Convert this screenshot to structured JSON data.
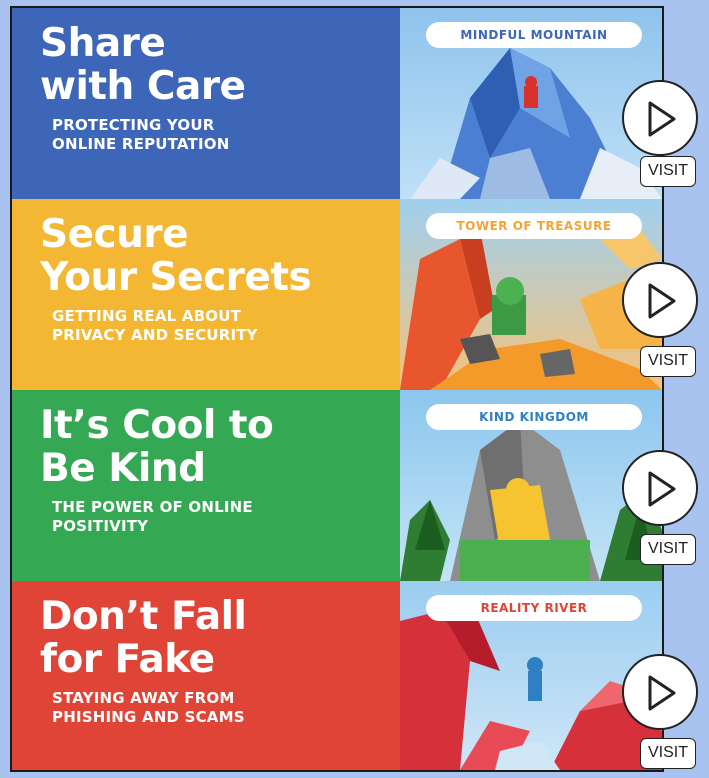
{
  "sections": [
    {
      "title_line1": "Share",
      "title_line2": "with Care",
      "subtitle_line1": "PROTECTING YOUR",
      "subtitle_line2": "ONLINE REPUTATION",
      "world": "MINDFUL MOUNTAIN",
      "panel_color": "#3d66b8",
      "world_text_color": "#3d66b8",
      "visit_label": "VISIT"
    },
    {
      "title_line1": "Secure",
      "title_line2": "Your Secrets",
      "subtitle_line1": "GETTING REAL ABOUT",
      "subtitle_line2": "PRIVACY AND SECURITY",
      "world": "TOWER OF TREASURE",
      "panel_color": "#f3b733",
      "world_text_color": "#f3a533",
      "visit_label": "VISIT"
    },
    {
      "title_line1": "It’s Cool to",
      "title_line2": "Be Kind",
      "subtitle_line1": "THE POWER OF ONLINE",
      "subtitle_line2": "POSITIVITY",
      "world": "KIND KINGDOM",
      "panel_color": "#34a853",
      "world_text_color": "#2f7fc4",
      "visit_label": "VISIT"
    },
    {
      "title_line1": "Don’t Fall",
      "title_line2": "for Fake",
      "subtitle_line1": "STAYING AWAY FROM",
      "subtitle_line2": "PHISHING AND SCAMS",
      "world": "REALITY RIVER",
      "panel_color": "#e04437",
      "world_text_color": "#e04437",
      "visit_label": "VISIT"
    }
  ],
  "icons": {
    "play": "play-icon"
  }
}
